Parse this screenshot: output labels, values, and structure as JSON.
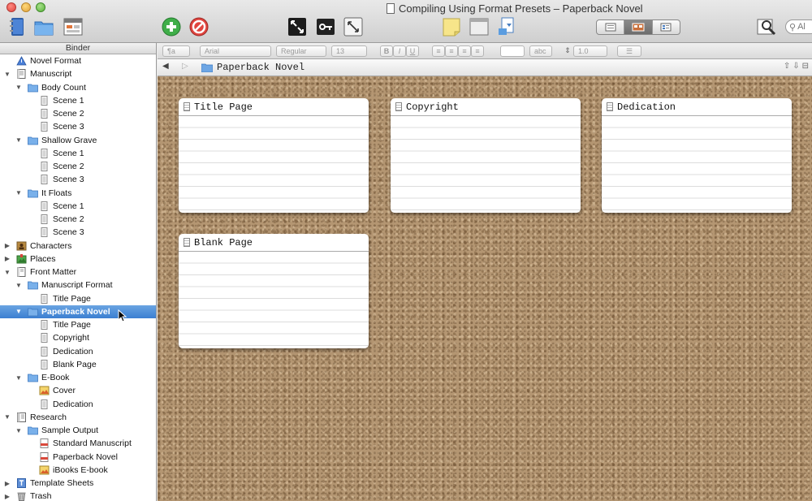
{
  "window": {
    "title": "Compiling Using Format Presets – Paperback Novel"
  },
  "toolbar": {
    "icons": [
      "binder-icon",
      "collections-icon",
      "composition-icon",
      "add-icon",
      "delete-icon",
      "fullscreen-icon",
      "keywords-icon",
      "zoom-icon",
      "note-icon",
      "layout-icon",
      "compile-icon",
      "inspector-icon"
    ],
    "search_placeholder": "Al"
  },
  "binder": {
    "header": "Binder",
    "items": [
      {
        "label": "Novel Format",
        "level": 0,
        "icon": "warning-icon",
        "disclosure": ""
      },
      {
        "label": "Manuscript",
        "level": 0,
        "icon": "manuscript-icon",
        "disclosure": "open"
      },
      {
        "label": "Body Count",
        "level": 1,
        "icon": "folder-icon",
        "disclosure": "open"
      },
      {
        "label": "Scene 1",
        "level": 2,
        "icon": "text-doc-icon",
        "disclosure": ""
      },
      {
        "label": "Scene 2",
        "level": 2,
        "icon": "text-doc-icon",
        "disclosure": ""
      },
      {
        "label": "Scene 3",
        "level": 2,
        "icon": "text-doc-icon",
        "disclosure": ""
      },
      {
        "label": "Shallow Grave",
        "level": 1,
        "icon": "folder-icon",
        "disclosure": "open"
      },
      {
        "label": "Scene 1",
        "level": 2,
        "icon": "text-doc-icon",
        "disclosure": ""
      },
      {
        "label": "Scene 2",
        "level": 2,
        "icon": "text-doc-icon",
        "disclosure": ""
      },
      {
        "label": "Scene 3",
        "level": 2,
        "icon": "text-doc-icon",
        "disclosure": ""
      },
      {
        "label": "It Floats",
        "level": 1,
        "icon": "folder-icon",
        "disclosure": "open"
      },
      {
        "label": "Scene 1",
        "level": 2,
        "icon": "text-doc-icon",
        "disclosure": ""
      },
      {
        "label": "Scene 2",
        "level": 2,
        "icon": "text-doc-icon",
        "disclosure": ""
      },
      {
        "label": "Scene 3",
        "level": 2,
        "icon": "text-doc-icon",
        "disclosure": ""
      },
      {
        "label": "Characters",
        "level": 0,
        "icon": "characters-icon",
        "disclosure": "closed"
      },
      {
        "label": "Places",
        "level": 0,
        "icon": "places-icon",
        "disclosure": "closed"
      },
      {
        "label": "Front Matter",
        "level": 0,
        "icon": "front-matter-icon",
        "disclosure": "open"
      },
      {
        "label": "Manuscript Format",
        "level": 1,
        "icon": "folder-icon",
        "disclosure": "open"
      },
      {
        "label": "Title Page",
        "level": 2,
        "icon": "text-doc-icon",
        "disclosure": ""
      },
      {
        "label": "Paperback Novel",
        "level": 1,
        "icon": "folder-icon",
        "disclosure": "open",
        "selected": true
      },
      {
        "label": "Title Page",
        "level": 2,
        "icon": "text-doc-icon",
        "disclosure": ""
      },
      {
        "label": "Copyright",
        "level": 2,
        "icon": "text-doc-icon",
        "disclosure": ""
      },
      {
        "label": "Dedication",
        "level": 2,
        "icon": "text-doc-icon",
        "disclosure": ""
      },
      {
        "label": "Blank Page",
        "level": 2,
        "icon": "text-doc-icon",
        "disclosure": ""
      },
      {
        "label": "E-Book",
        "level": 1,
        "icon": "folder-icon",
        "disclosure": "open"
      },
      {
        "label": "Cover",
        "level": 2,
        "icon": "image-icon",
        "disclosure": ""
      },
      {
        "label": "Dedication",
        "level": 2,
        "icon": "text-doc-icon",
        "disclosure": ""
      },
      {
        "label": "Research",
        "level": 0,
        "icon": "research-icon",
        "disclosure": "open"
      },
      {
        "label": "Sample Output",
        "level": 1,
        "icon": "folder-icon",
        "disclosure": "open"
      },
      {
        "label": "Standard Manuscript",
        "level": 2,
        "icon": "pdf-icon",
        "disclosure": ""
      },
      {
        "label": "Paperback Novel",
        "level": 2,
        "icon": "pdf-icon",
        "disclosure": ""
      },
      {
        "label": "iBooks E-book",
        "level": 2,
        "icon": "image-icon",
        "disclosure": ""
      },
      {
        "label": "Template Sheets",
        "level": 0,
        "icon": "template-icon",
        "disclosure": "closed"
      },
      {
        "label": "Trash",
        "level": 0,
        "icon": "trash-icon",
        "disclosure": "closed"
      }
    ]
  },
  "formatbar": {
    "style": "¶a",
    "font": "Arial",
    "weight": "Regular",
    "size": "13",
    "bold": "B",
    "italic": "I",
    "underline": "U",
    "highlight": "abc",
    "line_spacing": "1.0"
  },
  "header": {
    "title": "Paperback Novel",
    "back": "◀",
    "forward": "▷"
  },
  "corkboard": {
    "cards": [
      {
        "title": "Title Page"
      },
      {
        "title": "Copyright"
      },
      {
        "title": "Dedication"
      },
      {
        "title": "Blank Page"
      }
    ]
  },
  "colors": {
    "selection": "#3b7fd1",
    "cork": "#b49672",
    "accent_green": "#3fae49",
    "accent_red": "#e0443e"
  }
}
